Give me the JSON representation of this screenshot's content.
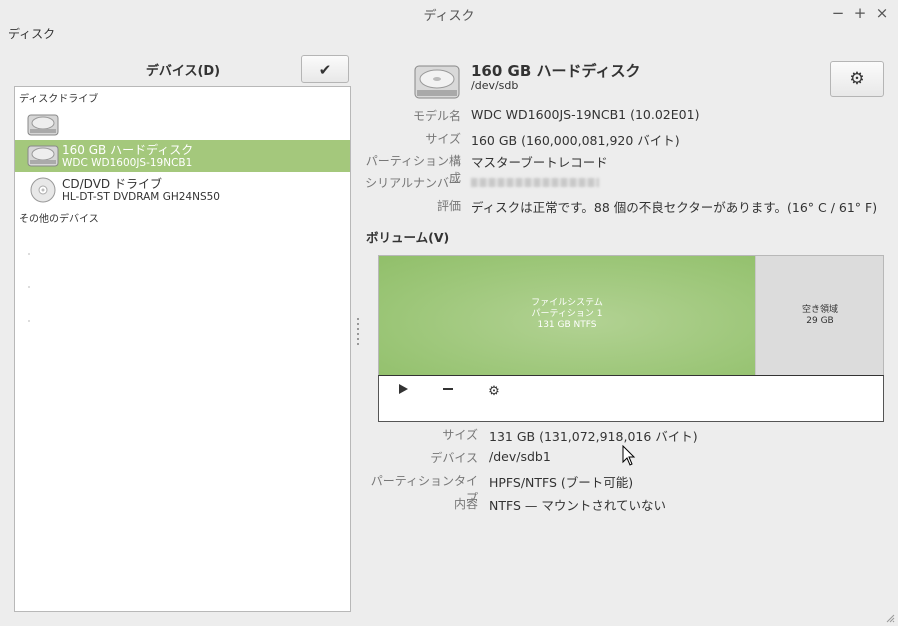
{
  "window": {
    "title": "ディスク"
  },
  "menubar": {
    "disk": "ディスク"
  },
  "devices": {
    "header": "デバイス(D)",
    "group_drives": "ディスクドライブ",
    "group_other": "その他のデバイス",
    "items": [
      {
        "name": "",
        "detail": ""
      },
      {
        "name": "160 GB ハードディスク",
        "detail": "WDC WD1600JS-19NCB1"
      },
      {
        "name": "CD/DVD ドライブ",
        "detail": "HL-DT-ST DVDRAM GH24NS50"
      }
    ]
  },
  "disk": {
    "title": "160 GB ハードディスク",
    "path": "/dev/sdb",
    "props": [
      {
        "label": "モデル名",
        "value": "WDC WD1600JS-19NCB1 (10.02E01)"
      },
      {
        "label": "サイズ",
        "value": "160 GB (160,000,081,920 バイト)"
      },
      {
        "label": "パーティション構成",
        "value": "マスターブートレコード"
      },
      {
        "label": "シリアルナンバー",
        "value": ""
      },
      {
        "label": "評価",
        "value": "ディスクは正常です。88 個の不良セクターがあります。(16° C / 61° F)"
      }
    ]
  },
  "volumes": {
    "header": "ボリューム(V)",
    "partition": {
      "line1": "ファイルシステム",
      "line2": "パーティション 1",
      "line3": "131 GB NTFS"
    },
    "free": {
      "line1": "空き領域",
      "line2": "29 GB"
    },
    "props": [
      {
        "label": "サイズ",
        "value": "131 GB (131,072,918,016 バイト)"
      },
      {
        "label": "デバイス",
        "value": "/dev/sdb1"
      },
      {
        "label": "パーティションタイプ",
        "value": "HPFS/NTFS (ブート可能)"
      },
      {
        "label": "内容",
        "value": "NTFS — マウントされていない"
      }
    ]
  },
  "icons": {
    "check": "checkmark-icon",
    "gear": "gear-icon",
    "play": "play-icon",
    "remove": "minus-icon",
    "settings": "gears-icon"
  },
  "colors": {
    "selection": "#a4c87c",
    "partition": "#9cc678",
    "free": "#dcdcdc",
    "background": "#ededed"
  }
}
